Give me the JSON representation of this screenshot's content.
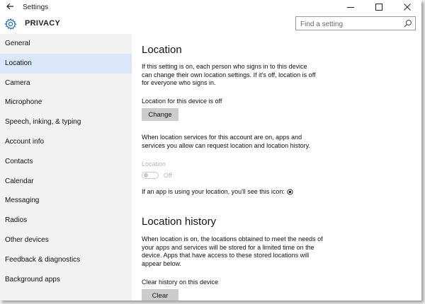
{
  "window": {
    "title": "Settings",
    "controls": {
      "minimize": "—",
      "maximize": "☐",
      "close": "✕"
    }
  },
  "header": {
    "title": "PRIVACY",
    "search_placeholder": "Find a setting"
  },
  "sidebar": {
    "items": [
      {
        "label": "General"
      },
      {
        "label": "Location"
      },
      {
        "label": "Camera"
      },
      {
        "label": "Microphone"
      },
      {
        "label": "Speech, inking, & typing"
      },
      {
        "label": "Account info"
      },
      {
        "label": "Contacts"
      },
      {
        "label": "Calendar"
      },
      {
        "label": "Messaging"
      },
      {
        "label": "Radios"
      },
      {
        "label": "Other devices"
      },
      {
        "label": "Feedback & diagnostics"
      },
      {
        "label": "Background apps"
      }
    ],
    "selected": "Location"
  },
  "content": {
    "location_heading": "Location",
    "location_intro": "If this setting is on, each person who signs in to this device can change their own location settings. If it's off, location is off for everyone who signs in.",
    "device_status": "Location for this device is off",
    "change_button": "Change",
    "services_text": "When location services for this account are on, apps and services you allow can request location and location history.",
    "location_toggle_label": "Location",
    "location_toggle_state": "Off",
    "icon_notice": "If an app is using your location, you'll see this icon:",
    "history_heading": "Location history",
    "history_text": "When location is on, the locations obtained to meet the needs of your apps and services will be stored for a limited time on the device. Apps that have access to these stored locations will appear below.",
    "clear_label": "Clear history on this device",
    "clear_button": "Clear"
  },
  "colors": {
    "sidebar_bg": "#f2f2f2",
    "selected_bg": "#dae7f8",
    "accent": "#1e6fc2",
    "button_bg": "#cccccc",
    "disabled_text": "#b5b5b5"
  }
}
